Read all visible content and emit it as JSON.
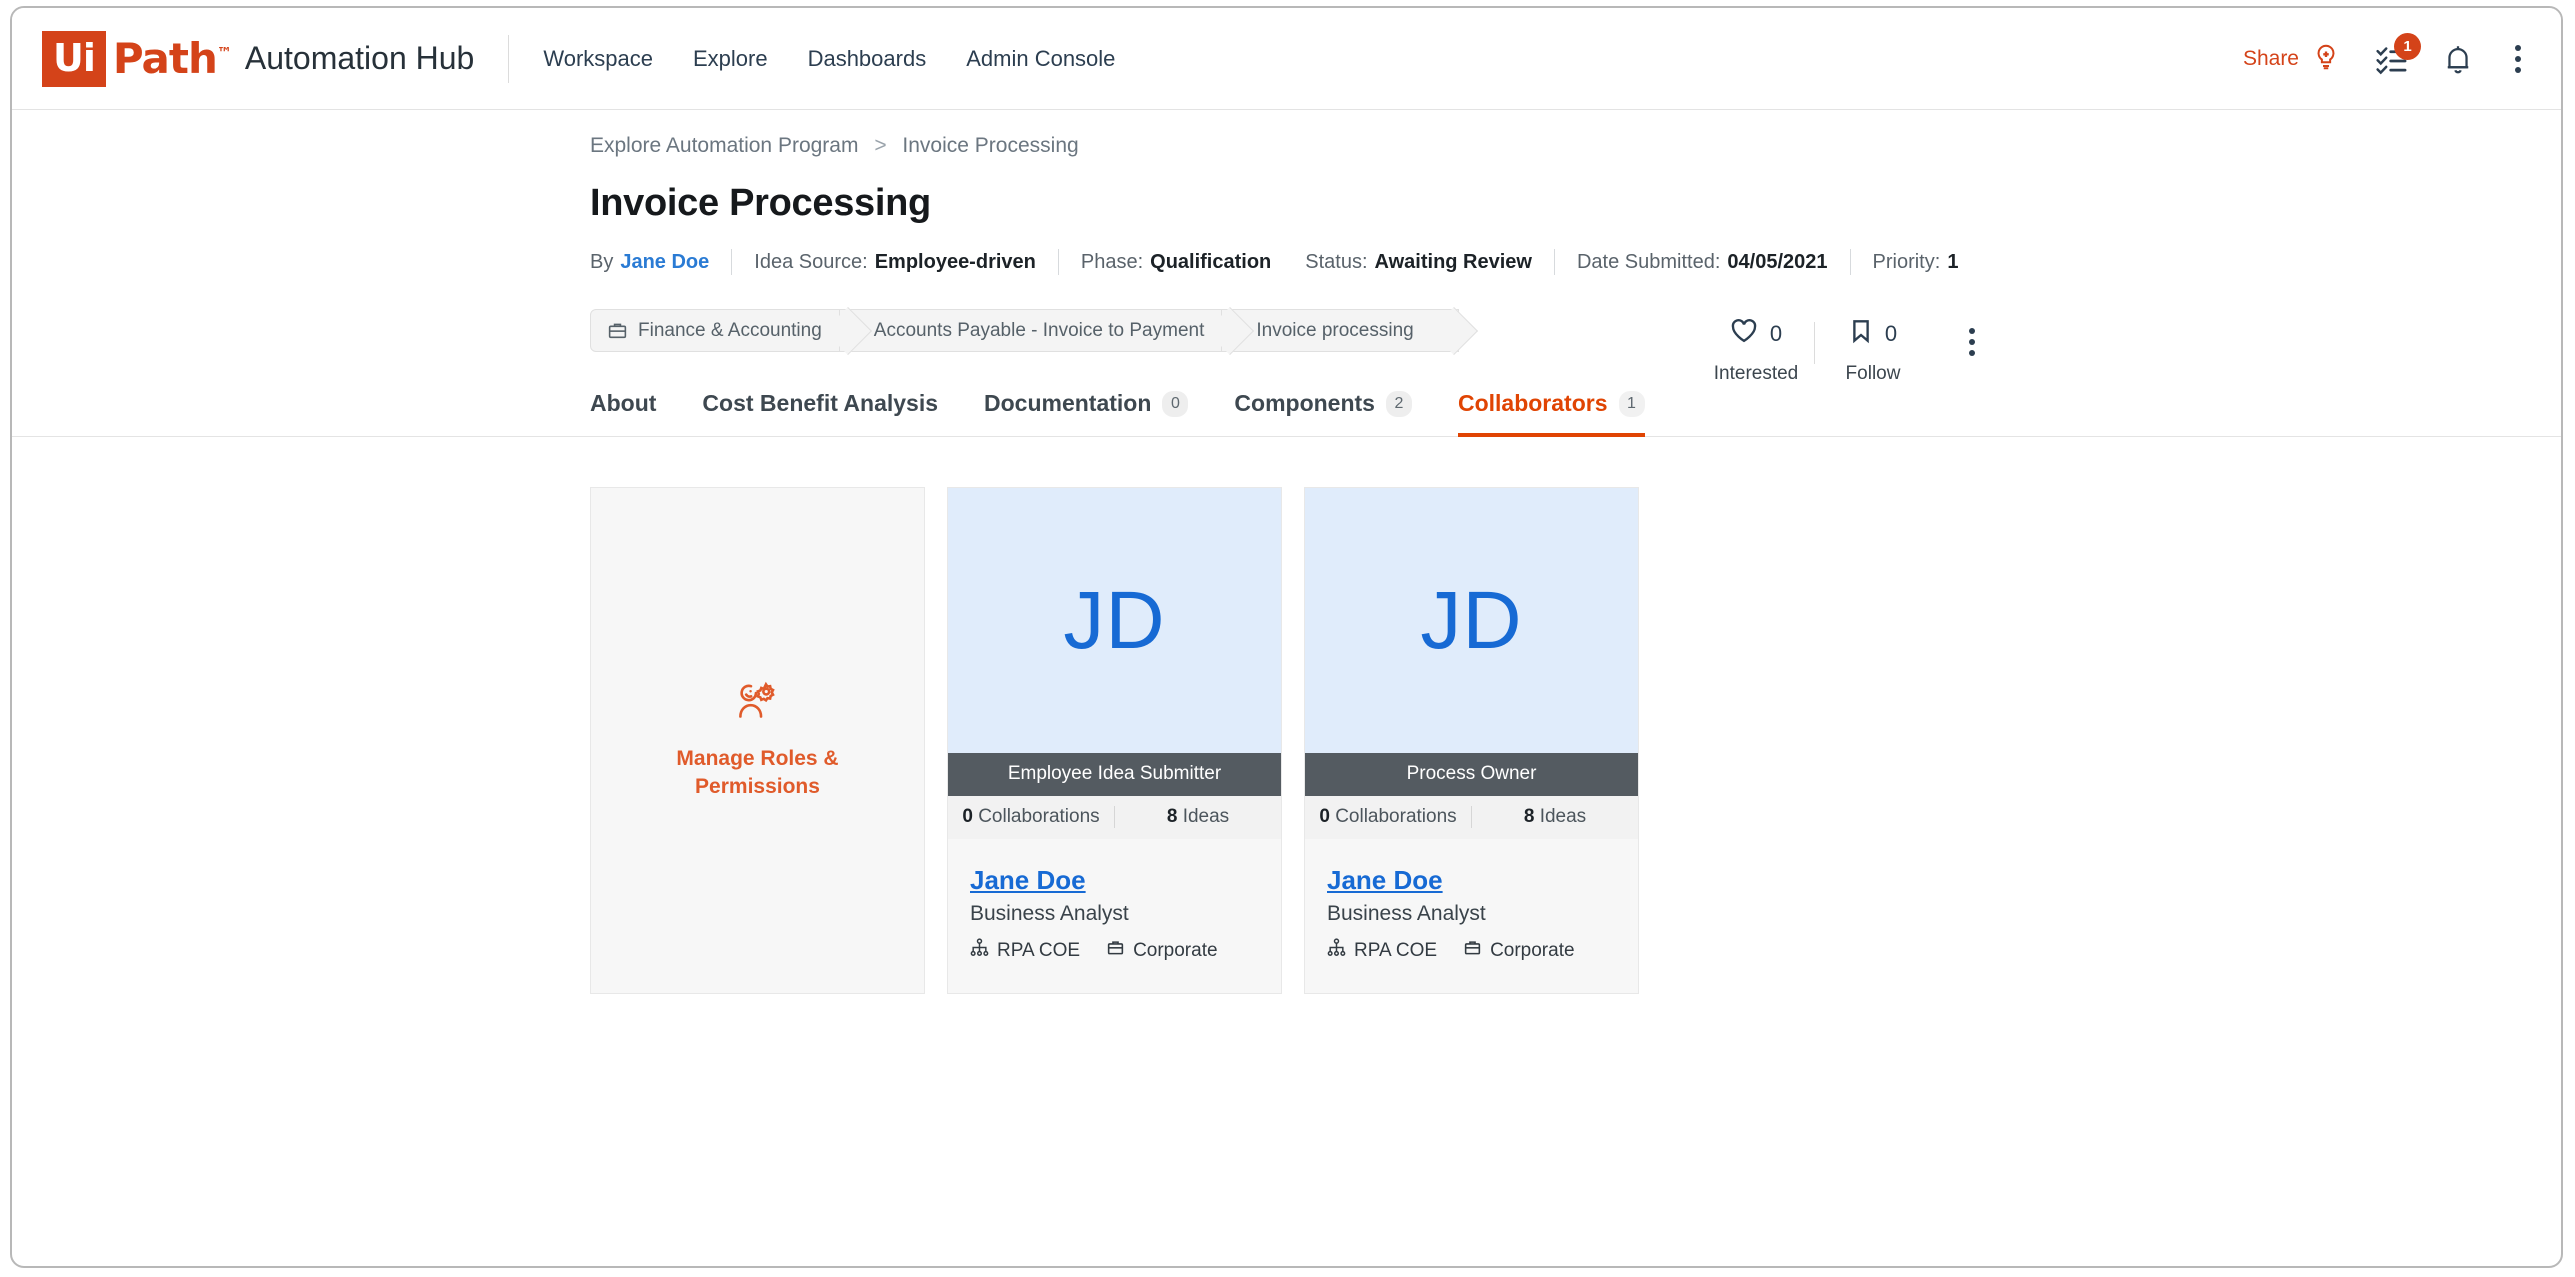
{
  "header": {
    "brand_name": "Automation Hub",
    "logo_ui": "Ui",
    "logo_path": "Path",
    "logo_tm": "™",
    "nav": [
      {
        "label": "Workspace"
      },
      {
        "label": "Explore"
      },
      {
        "label": "Dashboards"
      },
      {
        "label": "Admin Console"
      }
    ],
    "share_label": "Share",
    "tasks_badge": "1"
  },
  "breadcrumb": {
    "parent": "Explore Automation Program",
    "separator": ">",
    "current": "Invoice Processing"
  },
  "page_title": "Invoice Processing",
  "meta": {
    "by_label": "By",
    "by_value": "Jane Doe",
    "idea_source_label": "Idea Source:",
    "idea_source_value": "Employee-driven",
    "phase_label": "Phase:",
    "phase_value": "Qualification",
    "status_label": "Status:",
    "status_value": "Awaiting Review",
    "date_label": "Date Submitted:",
    "date_value": "04/05/2021",
    "priority_label": "Priority:",
    "priority_value": "1"
  },
  "engagement": {
    "interested_count": "0",
    "interested_label": "Interested",
    "follow_count": "0",
    "follow_label": "Follow"
  },
  "category_trail": [
    {
      "label": "Finance & Accounting",
      "has_icon": true
    },
    {
      "label": "Accounts Payable - Invoice to Payment",
      "has_icon": false
    },
    {
      "label": "Invoice processing",
      "has_icon": false
    }
  ],
  "tabs": [
    {
      "label": "About",
      "count": null,
      "active": false
    },
    {
      "label": "Cost Benefit Analysis",
      "count": null,
      "active": false
    },
    {
      "label": "Documentation",
      "count": "0",
      "active": false
    },
    {
      "label": "Components",
      "count": "2",
      "active": false
    },
    {
      "label": "Collaborators",
      "count": "1",
      "active": true
    }
  ],
  "manage_card": {
    "label_line1": "Manage Roles &",
    "label_line2": "Permissions"
  },
  "collaborators": [
    {
      "initials": "JD",
      "role": "Employee Idea Submitter",
      "collaborations_count": "0",
      "collaborations_label": "Collaborations",
      "ideas_count": "8",
      "ideas_label": "Ideas",
      "name": "Jane Doe",
      "job_title": "Business Analyst",
      "department": "RPA COE",
      "organization": "Corporate"
    },
    {
      "initials": "JD",
      "role": "Process Owner",
      "collaborations_count": "0",
      "collaborations_label": "Collaborations",
      "ideas_count": "8",
      "ideas_label": "Ideas",
      "name": "Jane Doe",
      "job_title": "Business Analyst",
      "department": "RPA COE",
      "organization": "Corporate"
    }
  ],
  "colors": {
    "brand_orange": "#d44319",
    "accent_orange": "#e04403",
    "link_blue": "#176ad4",
    "avatar_bg": "#e0ecfb",
    "role_banner_bg": "#545b61"
  }
}
